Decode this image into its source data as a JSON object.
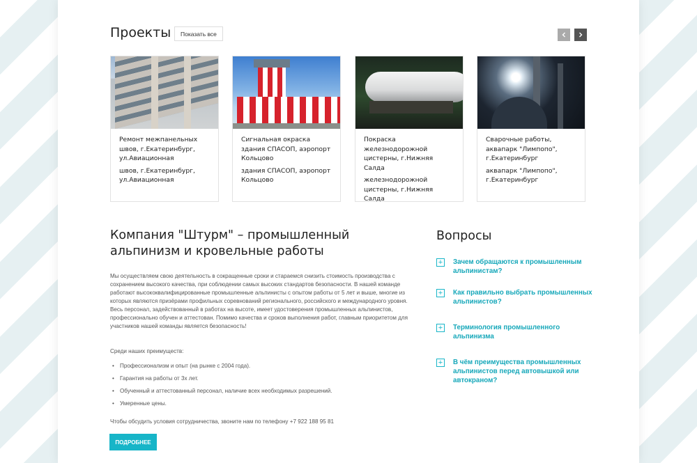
{
  "colors": {
    "accent": "#17b5c8",
    "faq_text": "#17a8ba",
    "arrow_prev": "#aaaaaa",
    "arrow_next": "#555555"
  },
  "projects": {
    "title": "Проекты",
    "show_all_label": "Показать все",
    "prev_icon": "chevron-left-icon",
    "next_icon": "chevron-right-icon",
    "cards": [
      {
        "image": "apartment-building-photo",
        "title": "Ремонт межпанельных швов, г.Екатеринбург, ул.Авиационная",
        "subtitle": "швов, г.Екатеринбург, ул.Авиационная"
      },
      {
        "image": "control-tower-photo",
        "title": "Сигнальная окраска здания СПАСОП, аэропорт Кольцово",
        "subtitle": "здания СПАСОП, аэропорт Кольцово"
      },
      {
        "image": "rail-tank-photo",
        "title": "Покраска железнодорожной цистерны, г.Нижняя Салда",
        "subtitle": "железнодорожной цистерны, г.Нижняя Салда"
      },
      {
        "image": "welding-photo",
        "title": "Сварочные работы, аквапарк \"Лимпопо\", г.Екатеринбург",
        "subtitle": "аквапарк \"Лимпопо\", г.Екатеринбург"
      }
    ]
  },
  "company": {
    "title": "Компания \"Штурм\" – промышленный альпинизм и кровельные работы",
    "description": "Мы осуществляем свою деятельность в сокращенные сроки и стараемся снизить стоимость производства с сохранением высокого качества, при соблюдении самых высоких стандартов безопасности. В нашей команде работают высококвалифицированные промышленные альпинисты с опытом работы от 5 лет и выше, многие из которых являются призёрами профильных соревнований регионального, российского и международного уровня. Весь персонал, задействованный в работах на высоте, имеет удостоверения промышленных альпинистов, профессионально обучен и аттестован. Помимо качества и сроков выполнения работ, главным приоритетом для участников нашей команды является безопасность!",
    "advantages_title": "Среди наших преимуществ:",
    "advantages": [
      "Профессионализм и опыт (на рынке с 2004 года).",
      "Гарантия на работы от 3х лет.",
      "Обученный и аттестованный персонал, наличие всех необходимых разрешений.",
      "Умеренные цены."
    ],
    "contact_text": "Чтобы обсудить условия сотрудничества, звоните нам по телефону +7 922 188 95 81",
    "more_button": "ПОДРОБНЕЕ"
  },
  "faq": {
    "title": "Вопросы",
    "expand_icon": "plus-icon",
    "items": [
      {
        "question": "Зачем обращаются к промышленным альпинистам?"
      },
      {
        "question": "Как правильно выбрать промышленных альпинистов?"
      },
      {
        "question": "Терминология промышленного альпинизма"
      },
      {
        "question": "В чём преимущества промышленных альпинистов перед автовышкой или автокраном?"
      }
    ]
  }
}
